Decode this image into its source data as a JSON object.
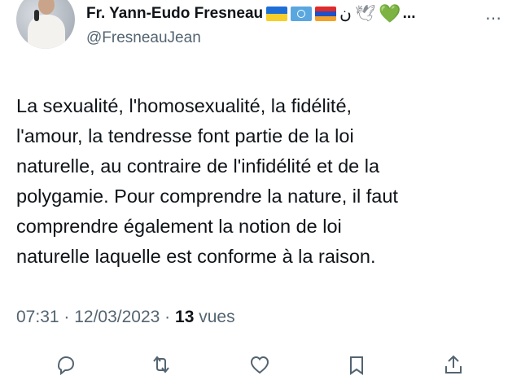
{
  "author": {
    "display_name": "Fr. Yann-Eudo Fresneau",
    "handle": "@FresneauJean",
    "name_emojis": [
      "ukraine-flag",
      "un-flag",
      "armenia-flag",
      "arabic-nun",
      "dove",
      "green-heart"
    ],
    "nun_glyph": "ن",
    "dove_glyph": "🕊",
    "heart_glyph": "💚",
    "truncation": "...",
    "more_label": "⋯"
  },
  "tweet": {
    "lines": [
      "La sexualité, l'homosexualité, la fidélité,",
      "l'amour, la tendresse font partie de la loi",
      "naturelle, au contraire de l'infidélité et de la",
      "polygamie. Pour  comprendre la nature, il faut",
      "comprendre également la notion de loi",
      "naturelle laquelle est conforme à la raison."
    ]
  },
  "meta": {
    "time": "07:31",
    "separator": " · ",
    "date": "12/03/2023",
    "views_count": "13",
    "views_label": " vues"
  },
  "actions": [
    "reply-icon",
    "retweet-icon",
    "like-icon",
    "bookmark-icon",
    "share-icon"
  ],
  "colors": {
    "text": "#0f1419",
    "secondary": "#536471",
    "heart": "#3bbf3b"
  }
}
